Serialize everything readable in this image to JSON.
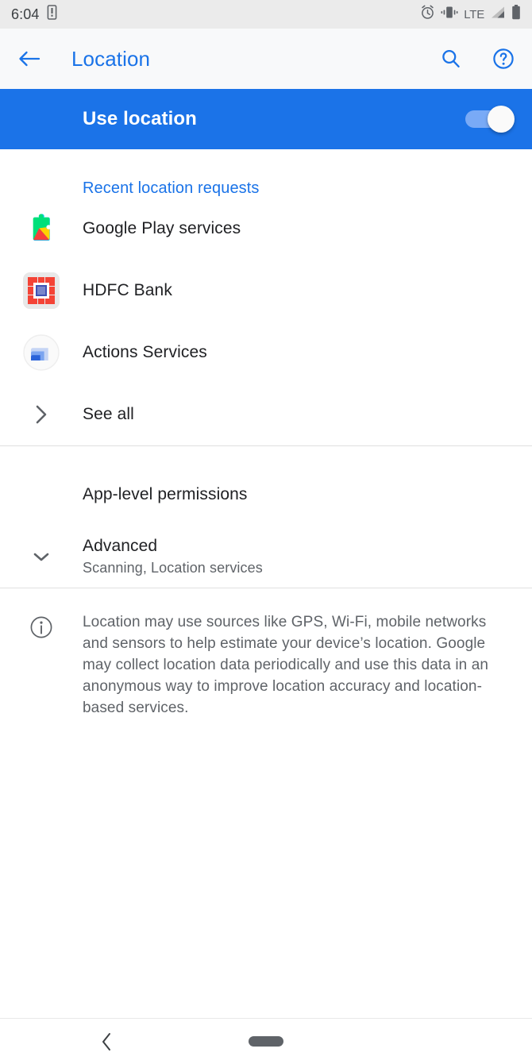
{
  "statusbar": {
    "time": "6:04",
    "left_icons": [
      "vibrate-phone-icon"
    ],
    "right_icons": [
      "alarm-icon",
      "vibrate-icon",
      "signal-icon",
      "battery-icon"
    ],
    "network_label": "LTE"
  },
  "appbar": {
    "back_icon": "back-arrow-icon",
    "title": "Location",
    "search_icon": "search-icon",
    "help_icon": "help-icon"
  },
  "master_switch": {
    "label": "Use location",
    "state": "on"
  },
  "recent_requests": {
    "title": "Recent location requests",
    "items": [
      {
        "label": "Google Play services",
        "icon": "google-play-services-icon"
      },
      {
        "label": "HDFC Bank",
        "icon": "hdfc-bank-icon"
      },
      {
        "label": "Actions Services",
        "icon": "actions-services-icon"
      }
    ],
    "see_all": {
      "label": "See all",
      "icon": "chevron-right-icon"
    }
  },
  "settings": {
    "app_level_permissions": {
      "label": "App-level permissions"
    },
    "advanced": {
      "label": "Advanced",
      "summary": "Scanning, Location services",
      "icon": "chevron-down-icon"
    }
  },
  "footer_info": {
    "icon": "info-icon",
    "text": "Location may use sources like GPS, Wi-Fi, mobile networks and sensors to help estimate your device’s location. Google may collect location data periodically and use this data in an anonymous way to improve location accuracy and location-based services."
  },
  "navbar": {
    "back_icon": "nav-back-icon",
    "home_pill": "nav-home-pill"
  },
  "colors": {
    "accent_blue": "#1a73e8",
    "master_bar": "#1b73e8",
    "statusbar_bg": "#ebebeb",
    "appbar_bg": "#f8f9fa",
    "primary_text": "#202124",
    "secondary_text": "#5f6368"
  }
}
